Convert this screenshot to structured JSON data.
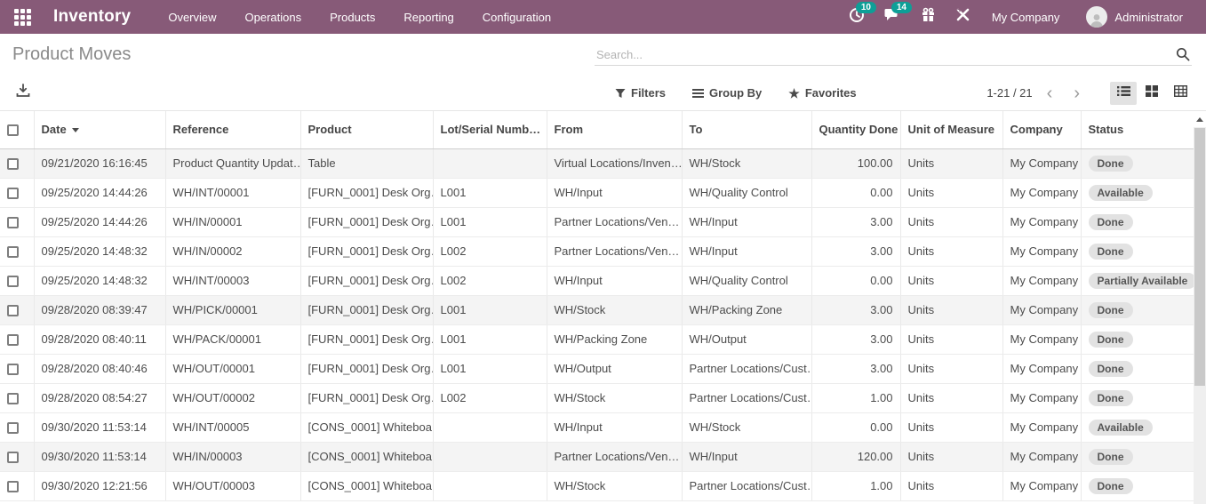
{
  "colors": {
    "nav_bg": "#875A78",
    "badge_bg": "#0E9F97",
    "pill_bg": "#e2e2e2"
  },
  "nav": {
    "app_name": "Inventory",
    "menus": [
      "Overview",
      "Operations",
      "Products",
      "Reporting",
      "Configuration"
    ],
    "activities_count": "10",
    "messages_count": "14",
    "company": "My Company",
    "user": "Administrator"
  },
  "icons": [
    "apps-grid",
    "clock-activities",
    "chat-messages",
    "gift",
    "tools-wrench",
    "avatar-person",
    "search-magnifier",
    "export-download",
    "filter-funnel",
    "group-by-bars",
    "favorites-star",
    "chevron-left",
    "chevron-right",
    "list-view",
    "kanban-view",
    "pivot-view",
    "sort-desc-arrow",
    "scroll-up-arrow"
  ],
  "breadcrumb": {
    "title": "Product Moves"
  },
  "search": {
    "placeholder": "Search..."
  },
  "control_bar": {
    "filters": "Filters",
    "group_by": "Group By",
    "favorites": "Favorites",
    "pager": "1-21 / 21",
    "prev": "‹",
    "next": "›"
  },
  "table": {
    "columns": [
      "Date",
      "Reference",
      "Product",
      "Lot/Serial Numb…",
      "From",
      "To",
      "Quantity Done",
      "Unit of Measure",
      "Company",
      "Status"
    ],
    "rows": [
      {
        "date": "09/21/2020 16:16:45",
        "reference": "Product Quantity Updat…",
        "product": "Table",
        "lot": "",
        "from": "Virtual Locations/Inven…",
        "to": "WH/Stock",
        "qty": "100.00",
        "uom": "Units",
        "company": "My Company",
        "status": "Done"
      },
      {
        "date": "09/25/2020 14:44:26",
        "reference": "WH/INT/00001",
        "product": "[FURN_0001] Desk Org…",
        "lot": "L001",
        "from": "WH/Input",
        "to": "WH/Quality Control",
        "qty": "0.00",
        "uom": "Units",
        "company": "My Company",
        "status": "Available"
      },
      {
        "date": "09/25/2020 14:44:26",
        "reference": "WH/IN/00001",
        "product": "[FURN_0001] Desk Org…",
        "lot": "L001",
        "from": "Partner Locations/Ven…",
        "to": "WH/Input",
        "qty": "3.00",
        "uom": "Units",
        "company": "My Company",
        "status": "Done"
      },
      {
        "date": "09/25/2020 14:48:32",
        "reference": "WH/IN/00002",
        "product": "[FURN_0001] Desk Org…",
        "lot": "L002",
        "from": "Partner Locations/Ven…",
        "to": "WH/Input",
        "qty": "3.00",
        "uom": "Units",
        "company": "My Company",
        "status": "Done"
      },
      {
        "date": "09/25/2020 14:48:32",
        "reference": "WH/INT/00003",
        "product": "[FURN_0001] Desk Org…",
        "lot": "L002",
        "from": "WH/Input",
        "to": "WH/Quality Control",
        "qty": "0.00",
        "uom": "Units",
        "company": "My Company",
        "status": "Partially Available"
      },
      {
        "date": "09/28/2020 08:39:47",
        "reference": "WH/PICK/00001",
        "product": "[FURN_0001] Desk Org…",
        "lot": "L001",
        "from": "WH/Stock",
        "to": "WH/Packing Zone",
        "qty": "3.00",
        "uom": "Units",
        "company": "My Company",
        "status": "Done"
      },
      {
        "date": "09/28/2020 08:40:11",
        "reference": "WH/PACK/00001",
        "product": "[FURN_0001] Desk Org…",
        "lot": "L001",
        "from": "WH/Packing Zone",
        "to": "WH/Output",
        "qty": "3.00",
        "uom": "Units",
        "company": "My Company",
        "status": "Done"
      },
      {
        "date": "09/28/2020 08:40:46",
        "reference": "WH/OUT/00001",
        "product": "[FURN_0001] Desk Org…",
        "lot": "L001",
        "from": "WH/Output",
        "to": "Partner Locations/Cust…",
        "qty": "3.00",
        "uom": "Units",
        "company": "My Company",
        "status": "Done"
      },
      {
        "date": "09/28/2020 08:54:27",
        "reference": "WH/OUT/00002",
        "product": "[FURN_0001] Desk Org…",
        "lot": "L002",
        "from": "WH/Stock",
        "to": "Partner Locations/Cust…",
        "qty": "1.00",
        "uom": "Units",
        "company": "My Company",
        "status": "Done"
      },
      {
        "date": "09/30/2020 11:53:14",
        "reference": "WH/INT/00005",
        "product": "[CONS_0001] Whiteboa…",
        "lot": "",
        "from": "WH/Input",
        "to": "WH/Stock",
        "qty": "0.00",
        "uom": "Units",
        "company": "My Company",
        "status": "Available"
      },
      {
        "date": "09/30/2020 11:53:14",
        "reference": "WH/IN/00003",
        "product": "[CONS_0001] Whiteboa…",
        "lot": "",
        "from": "Partner Locations/Ven…",
        "to": "WH/Input",
        "qty": "120.00",
        "uom": "Units",
        "company": "My Company",
        "status": "Done"
      },
      {
        "date": "09/30/2020 12:21:56",
        "reference": "WH/OUT/00003",
        "product": "[CONS_0001] Whiteboa…",
        "lot": "",
        "from": "WH/Stock",
        "to": "Partner Locations/Cust…",
        "qty": "1.00",
        "uom": "Units",
        "company": "My Company",
        "status": "Done"
      }
    ]
  }
}
